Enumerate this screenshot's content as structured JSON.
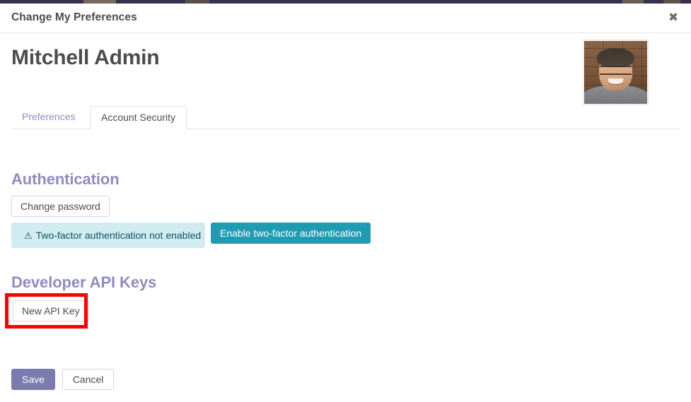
{
  "window": {
    "title": "Change My Preferences",
    "close_icon": "close-icon",
    "close_glyph": "✖"
  },
  "record": {
    "name": "Mitchell Admin",
    "avatar_alt": "user-avatar-photo"
  },
  "tabs": [
    {
      "label": "Preferences",
      "active": false
    },
    {
      "label": "Account Security",
      "active": true
    }
  ],
  "sections": {
    "authentication": {
      "title": "Authentication",
      "change_password_label": "Change password",
      "alert": {
        "icon": "warning-triangle-icon",
        "icon_glyph": "⚠",
        "text": "Two-factor authentication not enabled"
      },
      "enable_2fa_label": "Enable two-factor authentication"
    },
    "developer_api_keys": {
      "title": "Developer API Keys",
      "new_api_key_label": "New API Key"
    }
  },
  "footer": {
    "save_label": "Save",
    "cancel_label": "Cancel"
  },
  "colors": {
    "navbar": "#35314e",
    "accent_purple": "#7c7bad",
    "heading_purple": "#8f8cc0",
    "info_teal": "#1f9bb2",
    "alert_bg": "#d1ecf1",
    "alert_text": "#0c5460",
    "highlight_red": "#fe0000"
  }
}
